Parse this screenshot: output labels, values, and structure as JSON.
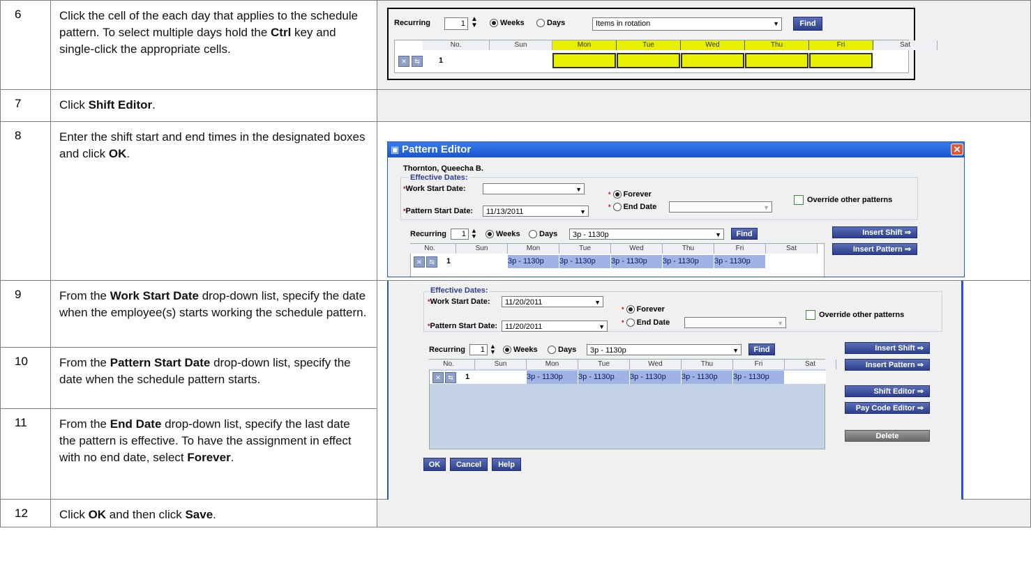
{
  "steps": [
    {
      "num": "6",
      "text_html": "Click the cell of the each day that applies to the schedule pattern. To select multiple days hold the <b>Ctrl</b> key and single-click the appropriate cells."
    },
    {
      "num": "7",
      "text_html": "Click <b>Shift Editor</b>."
    },
    {
      "num": "8",
      "text_html": "Enter the shift start and end times in the designated boxes and click <b>OK</b>."
    },
    {
      "num": "9",
      "text_html": "From the <b>Work Start Date</b> drop-down list, specify the date when the employee(s) starts working the schedule pattern."
    },
    {
      "num": "10",
      "text_html": "From the <b>Pattern Start Date</b> drop-down list, specify the date when the schedule pattern starts."
    },
    {
      "num": "11",
      "text_html": "From the <b>End Date</b> drop-down list, specify the last date the pattern is effective. To have the assignment in effect with no end date, select <b>Forever</b>."
    },
    {
      "num": "12",
      "text_html": "Click <b>OK</b> and then click <b>Save</b>."
    }
  ],
  "shot1": {
    "recurring": "Recurring",
    "spin": "1",
    "weeks": "Weeks",
    "days": "Days",
    "combo": "Items in rotation",
    "find": "Find",
    "headers": [
      "No.",
      "Sun",
      "Mon",
      "Tue",
      "Wed",
      "Thu",
      "Fri",
      "Sat"
    ],
    "row_no": "1",
    "highlight_color": "#e6f000"
  },
  "shot2": {
    "title": "Pattern Editor",
    "employee": "Thornton, Queecha B.",
    "effective": "Effective Dates:",
    "work_start": "Work Start Date:",
    "pattern_start": "Pattern Start Date:",
    "pattern_start_val": "11/13/2011",
    "forever": "Forever",
    "end_date": "End Date",
    "override": "Override other patterns",
    "recurring": "Recurring",
    "spin": "1",
    "weeks": "Weeks",
    "days": "Days",
    "combo": "3p - 1130p",
    "find": "Find",
    "insert_shift": "Insert Shift ⇒",
    "insert_pattern": "Insert Pattern ⇒",
    "headers": [
      "No.",
      "Sun",
      "Mon",
      "Tue",
      "Wed",
      "Thu",
      "Fri",
      "Sat"
    ],
    "row_no": "1",
    "cells": [
      "3p - 1130p",
      "3p - 1130p",
      "3p - 1130p",
      "3p - 1130p",
      "3p - 1130p"
    ]
  },
  "shot3": {
    "effective": "Effective Dates:",
    "work_start": "Work Start Date:",
    "work_start_val": "11/20/2011",
    "pattern_start": "Pattern Start Date:",
    "pattern_start_val": "11/20/2011",
    "forever": "Forever",
    "end_date": "End Date",
    "override": "Override other patterns",
    "recurring": "Recurring",
    "spin": "1",
    "weeks": "Weeks",
    "days": "Days",
    "combo": "3p - 1130p",
    "find": "Find",
    "insert_shift": "Insert Shift ⇒",
    "insert_pattern": "Insert Pattern ⇒",
    "shift_editor": "Shift Editor ⇒",
    "pay_code_editor": "Pay Code Editor ⇒",
    "delete": "Delete",
    "ok": "OK",
    "cancel": "Cancel",
    "help": "Help",
    "headers": [
      "No.",
      "Sun",
      "Mon",
      "Tue",
      "Wed",
      "Thu",
      "Fri",
      "Sat"
    ],
    "row_no": "1",
    "cells": [
      "3p - 1130p",
      "3p - 1130p",
      "3p - 1130p",
      "3p - 1130p",
      "3p - 1130p"
    ]
  }
}
